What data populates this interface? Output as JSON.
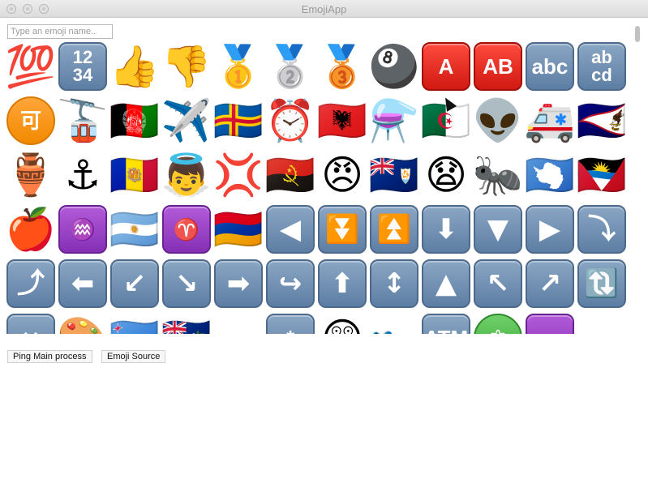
{
  "window": {
    "title": "EmojiApp"
  },
  "search": {
    "placeholder": "Type an emoji name.."
  },
  "buttons": {
    "ping": "Ping Main process",
    "source": "Emoji Source"
  },
  "emojis": [
    {
      "name": "hundred-points-icon",
      "glyph": "💯"
    },
    {
      "name": "input-numbers-icon",
      "key": "blue",
      "text": "12\n34",
      "small": true
    },
    {
      "name": "thumbs-up-icon",
      "glyph": "👍"
    },
    {
      "name": "thumbs-down-icon",
      "glyph": "👎"
    },
    {
      "name": "first-place-medal-icon",
      "glyph": "🥇"
    },
    {
      "name": "second-place-medal-icon",
      "glyph": "🥈"
    },
    {
      "name": "third-place-medal-icon",
      "glyph": "🥉"
    },
    {
      "name": "pool-8-ball-icon",
      "glyph": "🎱"
    },
    {
      "name": "a-button-blood-type-icon",
      "key": "red",
      "text": "A"
    },
    {
      "name": "ab-button-blood-type-icon",
      "key": "red",
      "text": "AB"
    },
    {
      "name": "input-latin-lowercase-icon",
      "key": "blue",
      "text": "abc"
    },
    {
      "name": "input-latin-letters-icon",
      "key": "blue",
      "text": "ab\ncd",
      "small": true
    },
    {
      "name": "japanese-acceptable-button-icon",
      "key": "orange",
      "text": "可"
    },
    {
      "name": "aerial-tramway-icon",
      "glyph": "🚡"
    },
    {
      "name": "flag-afghanistan-icon",
      "glyph": "🇦🇫"
    },
    {
      "name": "airplane-icon",
      "glyph": "✈️"
    },
    {
      "name": "flag-aland-islands-icon",
      "glyph": "🇦🇽"
    },
    {
      "name": "alarm-clock-icon",
      "glyph": "⏰"
    },
    {
      "name": "flag-albania-icon",
      "glyph": "🇦🇱"
    },
    {
      "name": "alembic-icon",
      "glyph": "⚗️"
    },
    {
      "name": "flag-algeria-icon",
      "glyph": "🇩🇿"
    },
    {
      "name": "alien-icon",
      "glyph": "👽"
    },
    {
      "name": "ambulance-icon",
      "glyph": "🚑"
    },
    {
      "name": "flag-american-samoa-icon",
      "glyph": "🇦🇸"
    },
    {
      "name": "amphora-icon",
      "glyph": "🏺"
    },
    {
      "name": "anchor-icon",
      "glyph": "⚓"
    },
    {
      "name": "flag-andorra-icon",
      "glyph": "🇦🇩"
    },
    {
      "name": "baby-angel-icon",
      "glyph": "👼"
    },
    {
      "name": "anger-symbol-icon",
      "glyph": "💢"
    },
    {
      "name": "flag-angola-icon",
      "glyph": "🇦🇴"
    },
    {
      "name": "angry-face-icon",
      "glyph": "😠"
    },
    {
      "name": "flag-anguilla-icon",
      "glyph": "🇦🇮"
    },
    {
      "name": "anguished-face-icon",
      "glyph": "😧"
    },
    {
      "name": "ant-icon",
      "glyph": "🐜"
    },
    {
      "name": "flag-antarctica-icon",
      "glyph": "🇦🇶"
    },
    {
      "name": "flag-antigua-barbuda-icon",
      "glyph": "🇦🇬"
    },
    {
      "name": "red-apple-icon",
      "glyph": "🍎"
    },
    {
      "name": "aquarius-icon",
      "key": "purple",
      "text": "♒"
    },
    {
      "name": "flag-argentina-icon",
      "glyph": "🇦🇷"
    },
    {
      "name": "aries-icon",
      "key": "purple",
      "text": "♈"
    },
    {
      "name": "flag-armenia-icon",
      "glyph": "🇦🇲"
    },
    {
      "name": "reverse-button-icon",
      "key": "blue",
      "arrow": "◀"
    },
    {
      "name": "fast-down-button-icon",
      "key": "blue",
      "arrow": "⏬"
    },
    {
      "name": "fast-up-button-icon",
      "key": "blue",
      "arrow": "⏫"
    },
    {
      "name": "down-arrow-icon",
      "key": "blue",
      "arrow": "⬇"
    },
    {
      "name": "downwards-button-icon",
      "key": "blue",
      "arrow": "▼"
    },
    {
      "name": "play-button-icon",
      "key": "blue",
      "arrow": "▶"
    },
    {
      "name": "right-arrow-curving-down-icon",
      "key": "blue",
      "arrow": "⤵"
    },
    {
      "name": "right-arrow-curving-up-icon",
      "key": "blue",
      "arrow": "⤴"
    },
    {
      "name": "left-arrow-icon",
      "key": "blue",
      "arrow": "⬅"
    },
    {
      "name": "down-left-arrow-icon",
      "key": "blue",
      "arrow": "↙"
    },
    {
      "name": "down-right-arrow-icon",
      "key": "blue",
      "arrow": "↘"
    },
    {
      "name": "right-arrow-icon",
      "key": "blue",
      "arrow": "➡"
    },
    {
      "name": "left-arrow-curving-right-icon",
      "key": "blue",
      "arrow": "↪"
    },
    {
      "name": "up-arrow-icon",
      "key": "blue",
      "arrow": "⬆"
    },
    {
      "name": "up-down-arrow-icon",
      "key": "blue",
      "arrow": "↕"
    },
    {
      "name": "upwards-button-icon",
      "key": "blue",
      "arrow": "▲"
    },
    {
      "name": "up-left-arrow-icon",
      "key": "blue",
      "arrow": "↖"
    },
    {
      "name": "up-right-arrow-icon",
      "key": "blue",
      "arrow": "↗"
    },
    {
      "name": "clockwise-arrows-icon",
      "key": "blue",
      "arrow": "🔃"
    },
    {
      "name": "left-right-arrow-icon",
      "key": "blue",
      "arrow": "↔"
    },
    {
      "name": "art-icon",
      "glyph": "🎨"
    },
    {
      "name": "flag-aruba-icon",
      "glyph": "🇦🇼"
    },
    {
      "name": "flag-ascension-icon",
      "glyph": "🇦🇨"
    },
    {
      "name": "asterisk-icon",
      "glyph": " "
    },
    {
      "name": "astonished-icon",
      "key": "blue",
      "text": "*"
    },
    {
      "name": "astonished-face-icon",
      "glyph": "😲"
    },
    {
      "name": "athletic-shoe-icon",
      "glyph": "👟"
    },
    {
      "name": "atm-sign-icon",
      "key": "blue",
      "text": "ATM"
    },
    {
      "name": "atom-symbol-icon",
      "key": "green",
      "text": "⚛"
    },
    {
      "name": "purple-button-icon",
      "key": "purple",
      "text": " "
    },
    {
      "name": "blank-icon",
      "glyph": " "
    }
  ]
}
